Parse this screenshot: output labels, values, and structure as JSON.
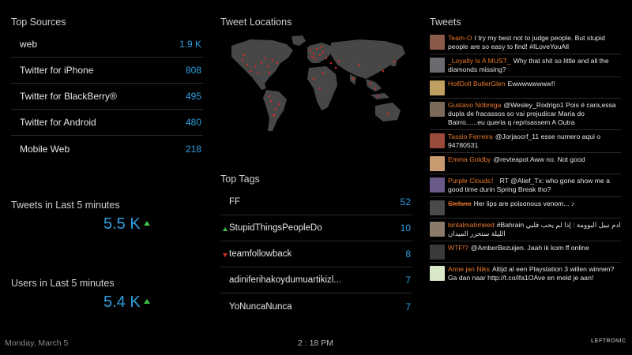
{
  "top_sources": {
    "title": "Top Sources",
    "items": [
      {
        "label": "web",
        "count": "1.9 K"
      },
      {
        "label": "Twitter for iPhone",
        "count": "808"
      },
      {
        "label": "Twitter for BlackBerry®",
        "count": "495"
      },
      {
        "label": "Twitter for Android",
        "count": "480"
      },
      {
        "label": "Mobile Web",
        "count": "218"
      }
    ]
  },
  "tweets_metric": {
    "title": "Tweets in Last 5 minutes",
    "value": "5.5 K",
    "trend": "up"
  },
  "users_metric": {
    "title": "Users in Last 5 minutes",
    "value": "5.4 K",
    "trend": "up"
  },
  "tweet_locations": {
    "title": "Tweet Locations"
  },
  "top_tags": {
    "title": "Top Tags",
    "items": [
      {
        "label": "FF",
        "count": "52",
        "trend": "none"
      },
      {
        "label": "StupidThingsPeopleDo",
        "count": "10",
        "trend": "up"
      },
      {
        "label": "teamfollowback",
        "count": "8",
        "trend": "down"
      },
      {
        "label": "adiniferihakoydumuartikizl...",
        "count": "7",
        "trend": "none"
      },
      {
        "label": "YoNuncaNunca",
        "count": "7",
        "trend": "none"
      }
    ]
  },
  "tweets": {
    "title": "Tweets",
    "items": [
      {
        "user": "Team-O",
        "text": "I try my best not to judge people. But stupid people are so easy to find! #ILoveYouAll",
        "avatar_color": "#8a5a4a"
      },
      {
        "user": "_Loyalty Is A MUST_",
        "text": "Why that shit so little and all the diamonds missing?",
        "avatar_color": "#6a6a70"
      },
      {
        "user": "HollDoll ButlerGlen",
        "text": "Ewwwwwwww!!",
        "avatar_color": "#c0a060"
      },
      {
        "user": "Gustavo Nóbrega",
        "text": "@Wesley_Rodrigo1 Pois é cara,essa dupla de fracassos so vai prejudicar Maria do Bairro......eu queria q reprisassem A Outra",
        "avatar_color": "#7a6a5a"
      },
      {
        "user": "Tassio Ferreira",
        "text": "@Jorjaocrf_11 esse numero aqui o 94780531",
        "avatar_color": "#9a4a3a"
      },
      {
        "user": "Emma Goldby",
        "text": "@revteapot Aww no. Not good",
        "avatar_color": "#c89a70"
      },
      {
        "user": "Purple Clouds！",
        "text": "RT @Alief_Tx: who gone show me a good time durin Spring Break tho?",
        "avatar_color": "#6a5a8a"
      },
      {
        "user": "Stefano",
        "text": "Her lips are poisonous venom... ♪",
        "avatar_color": "#4a4a4a"
      },
      {
        "user": "bintalmahmeed",
        "text": "#Bahrain ادم نبيل البوومة : إذا لم يحب قلبي الليلة ستحرر الميدان",
        "avatar_color": "#8a7a6a"
      },
      {
        "user": "WTF!?",
        "text": "@AmberBezuijen. Jaah ik kom ff online",
        "avatar_color": "#3a3a3a"
      },
      {
        "user": "Anne jan Niks",
        "text": "Altijd al een Playstation 3 willen winnen? Ga dan naar http://t.co/ifa1OAve en meld je aan!",
        "avatar_color": "#d8e8c8"
      }
    ]
  },
  "footer": {
    "date": "Monday, March 5",
    "time": "2 : 18 PM",
    "brand": "LEFTRONIC"
  },
  "colors": {
    "accent": "#2f9fe0",
    "username": "#e8782a",
    "up": "#3fc24a",
    "down": "#d0302a"
  }
}
